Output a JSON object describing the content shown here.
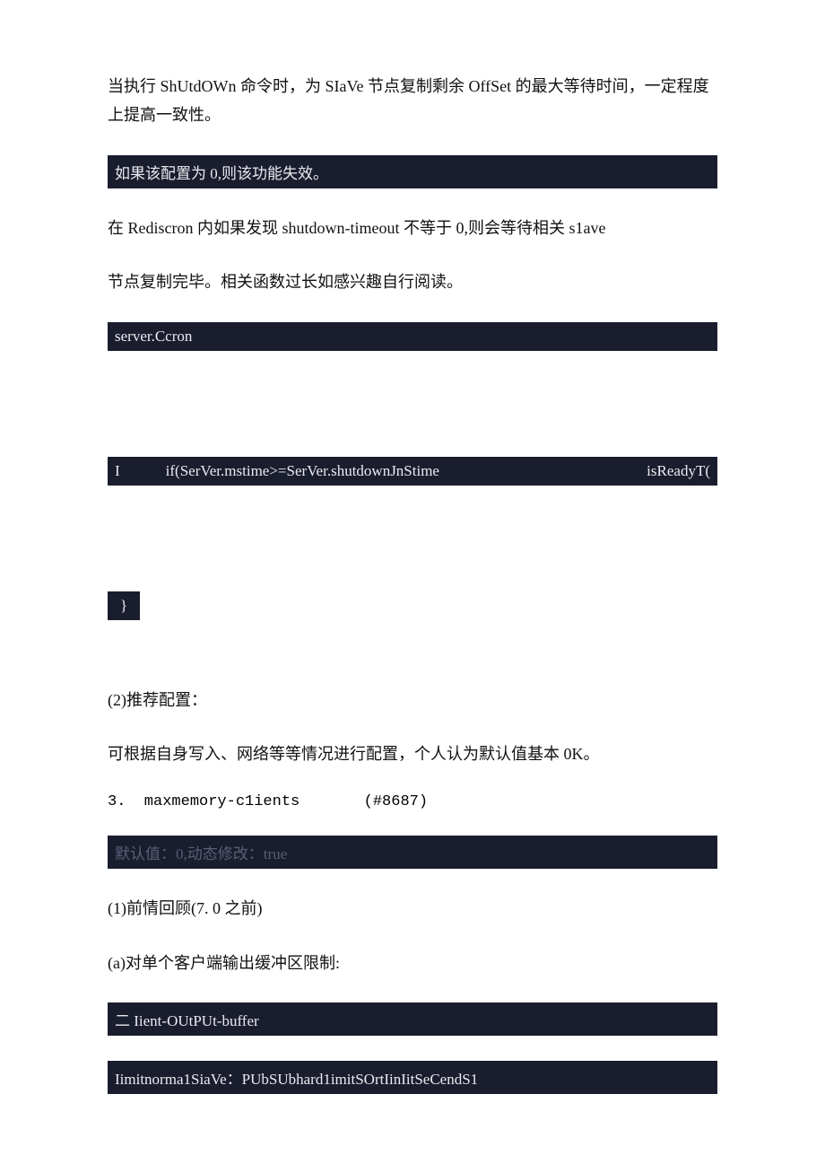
{
  "p1": "当执行 ShUtdOWn 命令时，为 SIaVe 节点复制剩余 OffSet 的最大等待时间，一定程度上提高一致性。",
  "bar1": "如果该配置为 0,则该功能失效。",
  "p2": "在 Rediscron 内如果发现 shutdown-timeout 不等于 0,则会等待相关 s1ave",
  "p3": "节点复制完毕。相关函数过长如感兴趣自行阅读。",
  "bar2": "server.Ccron",
  "spread_left": "I            if(SerVer.mstime>=SerVer.shutdownJnStime",
  "spread_right": "isReadyT(",
  "tiny_brace": "}",
  "p4": "(2)推荐配置：",
  "p5": "可根据自身写入、网络等等情况进行配置，个人认为默认值基本 0K。",
  "mono1": "3.  maxmemory-c1ients       (#8687)",
  "bar_dim": "默认值：0,动态修改：true",
  "p6": "(1)前情回顾(7. 0 之前)",
  "p7": "(a)对单个客户端输出缓冲区限制:",
  "bar3": "二 Iient-OUtPUt-buffer",
  "bar4": "Iimitnorma1SiaVe：PUbSUbhard1imitSOrtIinIitSeCendS1"
}
